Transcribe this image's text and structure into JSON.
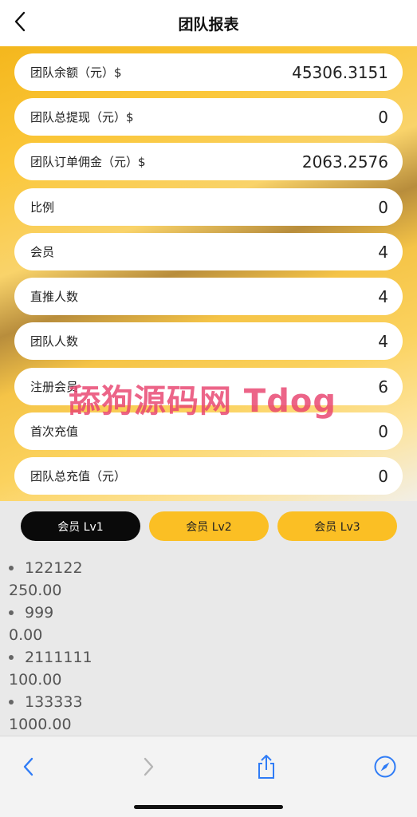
{
  "header": {
    "title": "团队报表"
  },
  "stats": [
    {
      "label": "团队余额（元）$",
      "value": "45306.3151"
    },
    {
      "label": "团队总提现（元）$",
      "value": "0"
    },
    {
      "label": "团队订单佣金（元）$",
      "value": "2063.2576"
    },
    {
      "label": "比例",
      "value": "0"
    },
    {
      "label": "会员",
      "value": "4"
    },
    {
      "label": "直推人数",
      "value": "4"
    },
    {
      "label": "团队人数",
      "value": "4"
    },
    {
      "label": "注册会员",
      "value": "6"
    },
    {
      "label": "首次充值",
      "value": "0"
    },
    {
      "label": "团队总充值（元）",
      "value": "0"
    }
  ],
  "watermark": "舔狗源码网 Tdog",
  "tabs": [
    {
      "label": "会员 Lv1",
      "active": true
    },
    {
      "label": "会员 Lv2",
      "active": false
    },
    {
      "label": "会员 Lv3",
      "active": false
    }
  ],
  "members": [
    {
      "id": "122122",
      "amount": "250.00"
    },
    {
      "id": "999",
      "amount": "0.00"
    },
    {
      "id": "2111111",
      "amount": "100.00"
    },
    {
      "id": "133333",
      "amount": "1000.00"
    }
  ],
  "icons": {
    "back": "chevron-left-icon",
    "nav_back": "chevron-left-icon",
    "nav_forward": "chevron-right-icon",
    "share": "share-icon",
    "compass": "compass-icon"
  },
  "colors": {
    "accent_yellow": "#fbbf24",
    "active_tab": "#0a0a0a",
    "ios_blue": "#2f7cf6"
  }
}
